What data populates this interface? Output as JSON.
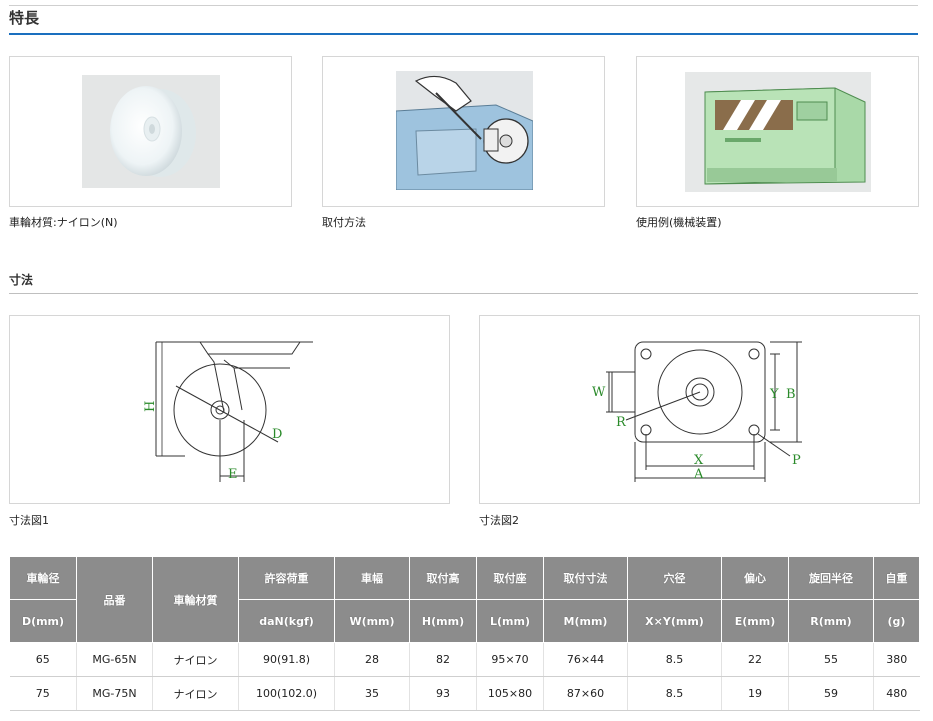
{
  "features": {
    "title": "特長",
    "items": [
      {
        "caption": "車輪材質:ナイロン(N)",
        "image": "nylon-wheel"
      },
      {
        "caption": "取付方法",
        "image": "mounting-method"
      },
      {
        "caption": "使用例(機械装置)",
        "image": "machine-example"
      }
    ]
  },
  "dimensions": {
    "title": "寸法",
    "fig1": {
      "caption": "寸法図1",
      "labels": {
        "h": "H",
        "d": "D",
        "e": "E"
      }
    },
    "fig2": {
      "caption": "寸法図2",
      "labels": {
        "w": "W",
        "y": "Y",
        "b": "B",
        "r": "R",
        "x": "X",
        "a": "A",
        "p": "P"
      }
    }
  },
  "spec_table": {
    "headers_top": [
      "車輪径",
      "品番",
      "車輪材質",
      "許容荷重",
      "車幅",
      "取付高",
      "取付座",
      "取付寸法",
      "穴径",
      "偏心",
      "旋回半径",
      "自重"
    ],
    "headers_bottom": [
      "D(mm)",
      "daN(kgf)",
      "W(mm)",
      "H(mm)",
      "L(mm)",
      "M(mm)",
      "X×Y(mm)",
      "E(mm)",
      "R(mm)",
      "(g)"
    ],
    "rows": [
      [
        "65",
        "MG-65N",
        "ナイロン",
        "90(91.8)",
        "28",
        "82",
        "95×70",
        "76×44",
        "8.5",
        "22",
        "55",
        "380"
      ],
      [
        "75",
        "MG-75N",
        "ナイロン",
        "100(102.0)",
        "35",
        "93",
        "105×80",
        "87×60",
        "8.5",
        "19",
        "59",
        "480"
      ]
    ]
  },
  "colors": {
    "heading_rule": "#1a6fbf",
    "table_header_bg": "#8c8c8c",
    "dimension_label": "#2a8a2a"
  }
}
